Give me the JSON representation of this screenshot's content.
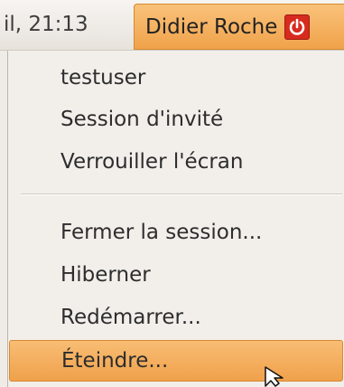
{
  "panel": {
    "clock": "il, 21:13",
    "user_name": "Didier Roche",
    "power_icon": "power-icon",
    "accent_color": "#f0a24a",
    "power_color": "#d72b1f"
  },
  "menu": {
    "items": [
      {
        "label": "testuser"
      },
      {
        "label": "Session d'invité"
      },
      {
        "label": "Verrouiller l'écran"
      },
      {
        "label": "Fermer la session..."
      },
      {
        "label": "Hiberner"
      },
      {
        "label": "Redémarrer..."
      },
      {
        "label": "Éteindre..."
      }
    ],
    "active_item": "Éteindre..."
  },
  "icons": {
    "cursor": "mouse-pointer-icon"
  }
}
